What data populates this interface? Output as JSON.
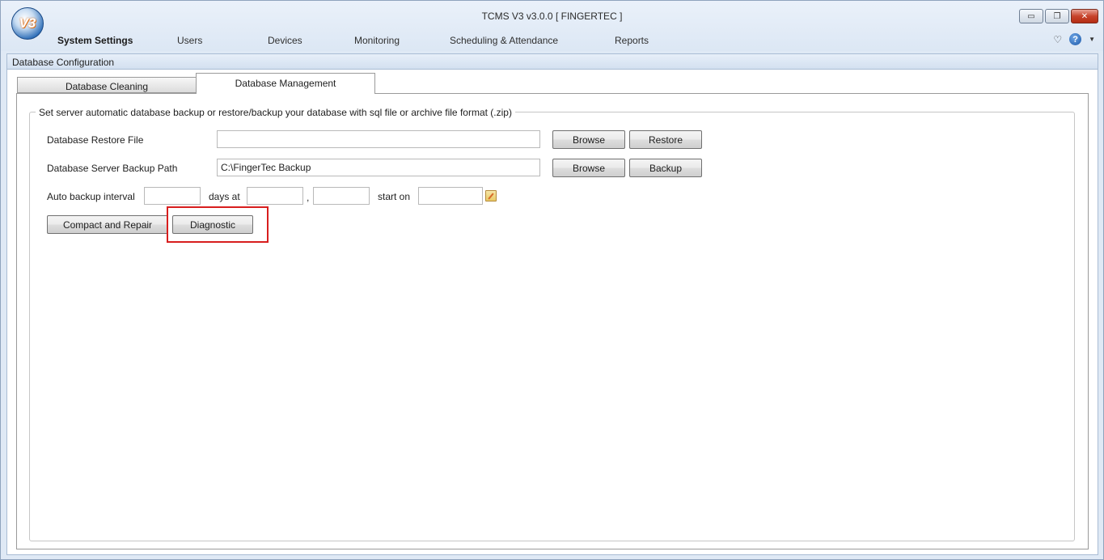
{
  "app": {
    "logo_text": "V3",
    "title": "TCMS V3 v3.0.0 [ FINGERTEC ]"
  },
  "window_controls": {
    "minimize": "▭",
    "restore": "❐",
    "close": "✕"
  },
  "menu": {
    "items": [
      {
        "label": "System Settings",
        "active": true
      },
      {
        "label": "Users"
      },
      {
        "label": "Devices"
      },
      {
        "label": "Monitoring"
      },
      {
        "label": "Scheduling & Attendance"
      },
      {
        "label": "Reports"
      }
    ],
    "heart_icon": "♡",
    "help_icon": "?",
    "dropdown_icon": "▼"
  },
  "section": {
    "title": "Database Configuration"
  },
  "tabs": [
    {
      "label": "Database Cleaning",
      "active": false
    },
    {
      "label": "Database Management",
      "active": true
    }
  ],
  "panel": {
    "legend": "Set server automatic database backup or restore/backup your database with sql file or archive file format (.zip)",
    "restore": {
      "label": "Database Restore File",
      "value": "",
      "browse_label": "Browse",
      "action_label": "Restore"
    },
    "backup_path": {
      "label": "Database Server Backup Path",
      "value": "C:\\FingerTec Backup",
      "browse_label": "Browse",
      "action_label": "Backup"
    },
    "auto_backup": {
      "label": "Auto backup interval",
      "interval_value": "",
      "days_at_label": "days at",
      "time1_value": "",
      "separator": ",",
      "time2_value": "",
      "start_on_label": "start on",
      "start_date_value": ""
    },
    "compact_label": "Compact and Repair",
    "diagnostic_label": "Diagnostic"
  },
  "colors": {
    "highlight": "#d81e1e",
    "header_bg": "#dfe9f5"
  }
}
